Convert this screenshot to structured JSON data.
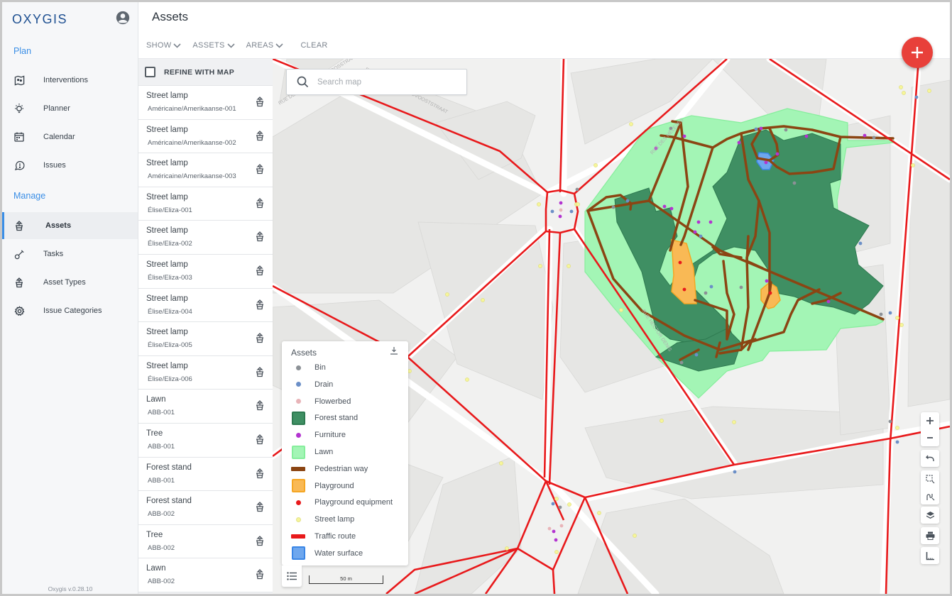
{
  "app": {
    "logo": "OXYGIS",
    "version": "Oxygis v.0.28.10"
  },
  "sidebar": {
    "sections": [
      {
        "label": "Plan",
        "items": [
          {
            "label": "Interventions",
            "icon": "map-icon"
          },
          {
            "label": "Planner",
            "icon": "lightbulb-icon"
          },
          {
            "label": "Calendar",
            "icon": "calendar-icon"
          },
          {
            "label": "Issues",
            "icon": "chat-alert-icon"
          }
        ]
      },
      {
        "label": "Manage",
        "items": [
          {
            "label": "Assets",
            "icon": "plant-pot-icon",
            "active": true
          },
          {
            "label": "Tasks",
            "icon": "shovel-icon"
          },
          {
            "label": "Asset Types",
            "icon": "plant-pot-icon"
          },
          {
            "label": "Issue Categories",
            "icon": "gear-icon"
          }
        ]
      }
    ]
  },
  "header": {
    "title": "Assets",
    "filters": {
      "show": "SHOW",
      "assets": "ASSETS",
      "areas": "AREAS",
      "clear": "CLEAR"
    }
  },
  "list": {
    "refine_label": "REFINE WITH MAP",
    "refine_checked": false,
    "items": [
      {
        "type": "Street lamp",
        "code": "Américaine/Amerikaanse-001"
      },
      {
        "type": "Street lamp",
        "code": "Américaine/Amerikaanse-002"
      },
      {
        "type": "Street lamp",
        "code": "Américaine/Amerikaanse-003"
      },
      {
        "type": "Street lamp",
        "code": "Élise/Eliza-001"
      },
      {
        "type": "Street lamp",
        "code": "Élise/Eliza-002"
      },
      {
        "type": "Street lamp",
        "code": "Élise/Eliza-003"
      },
      {
        "type": "Street lamp",
        "code": "Élise/Eliza-004"
      },
      {
        "type": "Street lamp",
        "code": "Élise/Eliza-005"
      },
      {
        "type": "Street lamp",
        "code": "Élise/Eliza-006"
      },
      {
        "type": "Lawn",
        "code": "ABB-001"
      },
      {
        "type": "Tree",
        "code": "ABB-001"
      },
      {
        "type": "Forest stand",
        "code": "ABB-001"
      },
      {
        "type": "Forest stand",
        "code": "ABB-002"
      },
      {
        "type": "Tree",
        "code": "ABB-002"
      },
      {
        "type": "Lawn",
        "code": "ABB-002"
      }
    ]
  },
  "map": {
    "search_placeholder": "Search map",
    "search_value": "",
    "scale_label": "50 m",
    "street_labels": [
      "RUE DU PRÉVÔT - PROVOOSTSTRAAT",
      "RUE DE TENBOSCH - TENBOSSTRAAT",
      "RUE DES MÊLÈZES",
      "RUE HECTOR DENIS"
    ],
    "legend": {
      "title": "Assets",
      "items": [
        {
          "label": "Bin",
          "kind": "dot",
          "color": "#8c9196"
        },
        {
          "label": "Drain",
          "kind": "dot",
          "color": "#6b8fc7"
        },
        {
          "label": "Flowerbed",
          "kind": "dot",
          "color": "#e8b4b8"
        },
        {
          "label": "Forest stand",
          "kind": "area",
          "color": "#3f8f63",
          "border": "#2e7a50"
        },
        {
          "label": "Furniture",
          "kind": "dot",
          "color": "#b334d0"
        },
        {
          "label": "Lawn",
          "kind": "area",
          "color": "#a3f5b5",
          "border": "#86ee9c"
        },
        {
          "label": "Pedestrian way",
          "kind": "line",
          "color": "#8b4513"
        },
        {
          "label": "Playground",
          "kind": "area",
          "color": "#f9b955",
          "border": "#f5a623"
        },
        {
          "label": "Playground equipment",
          "kind": "dot",
          "color": "#e8191b"
        },
        {
          "label": "Street lamp",
          "kind": "dot",
          "color": "#f6f59a"
        },
        {
          "label": "Traffic route",
          "kind": "line",
          "color": "#e8191b"
        },
        {
          "label": "Water surface",
          "kind": "area",
          "color": "#6ea7ee",
          "border": "#3a86e6"
        }
      ]
    },
    "controls": [
      "zoom-in",
      "zoom-out",
      "undo",
      "select-box",
      "select-lasso",
      "layers",
      "print",
      "measure"
    ]
  },
  "colors": {
    "accent": "#3a8ee6",
    "fab": "#e8403a",
    "traffic": "#e8191b",
    "path": "#8b4513",
    "forest": "#3f8f63",
    "lawn": "#a3f5b5"
  }
}
